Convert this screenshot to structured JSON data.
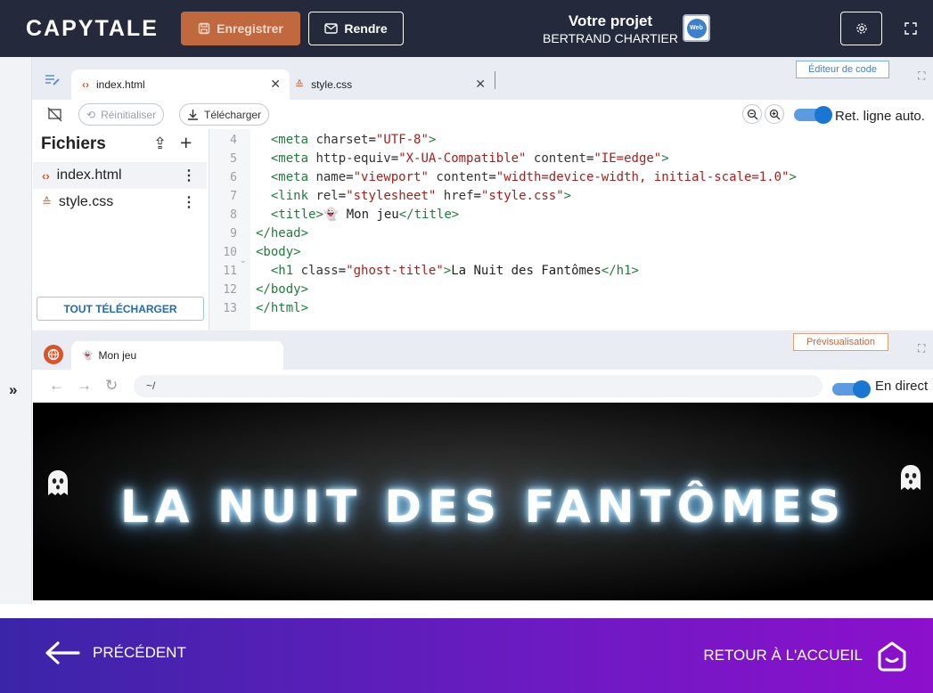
{
  "app": {
    "logo": "CAPYTALE",
    "save_label": "Enregistrer",
    "submit_label": "Rendre",
    "project_title": "Votre projet",
    "project_author": "BERTRAND CHARTIER",
    "web_badge": "Web"
  },
  "editor": {
    "panel_label": "Éditeur de code",
    "tabs": [
      {
        "label": "index.html",
        "icon": "code-icon"
      },
      {
        "label": "style.css",
        "icon": "css-icon"
      }
    ],
    "toolbar": {
      "reset_label": "Réinitialiser",
      "download_label": "Télécharger",
      "wrap_label": "Ret. ligne auto.",
      "wrap_enabled": true
    },
    "files": {
      "title": "Fichiers",
      "items": [
        {
          "name": "index.html",
          "icon": "code-icon"
        },
        {
          "name": "style.css",
          "icon": "css-icon"
        }
      ],
      "download_all_label": "TOUT TÉLÉCHARGER"
    },
    "line_numbers": [
      "4",
      "5",
      "6",
      "7",
      "8",
      "9",
      "10",
      "11",
      "12",
      "13"
    ],
    "code_lines": [
      "  <meta charset=\"UTF-8\">",
      "  <meta http-equiv=\"X-UA-Compatible\" content=\"IE=edge\">",
      "  <meta name=\"viewport\" content=\"width=device-width, initial-scale=1.0\">",
      "  <link rel=\"stylesheet\" href=\"style.css\">",
      "  <title>👻 Mon jeu</title>",
      "</head>",
      "<body>",
      "  <h1 class=\"ghost-title\">La Nuit des Fantômes</h1>",
      "</body>",
      "</html>"
    ]
  },
  "preview": {
    "panel_label": "Prévisualisation",
    "tab_label": "Mon jeu",
    "url": "~/",
    "live_label": "En direct",
    "live_enabled": true,
    "page_heading": "LA NUIT DES FANTÔMES"
  },
  "footer": {
    "previous_label": "PRÉCÉDENT",
    "home_label": "RETOUR À L'ACCUEIL"
  },
  "colors": {
    "topbar": "#24293b",
    "save_button": "#c2683e",
    "accent_blue": "#1976d2",
    "footer_start": "#3a25a8",
    "footer_end": "#8c10cc"
  }
}
